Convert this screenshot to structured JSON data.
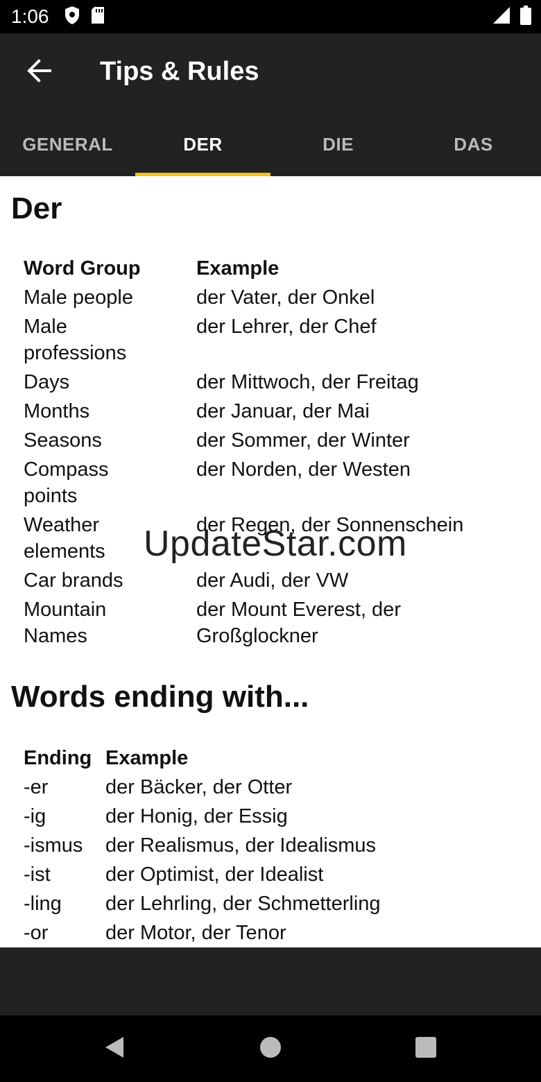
{
  "status": {
    "time": "1:06"
  },
  "app_bar": {
    "title": "Tips & Rules"
  },
  "tabs": [
    {
      "label": "GENERAL"
    },
    {
      "label": "DER"
    },
    {
      "label": "DIE"
    },
    {
      "label": "DAS"
    }
  ],
  "section1": {
    "title": "Der",
    "header": {
      "group": "Word Group",
      "example": "Example"
    },
    "rows": [
      {
        "group": "Male people",
        "example": "der Vater, der Onkel"
      },
      {
        "group": "Male",
        "group2": "professions",
        "example": "der Lehrer, der Chef"
      },
      {
        "group": "Days",
        "example": "der Mittwoch, der Freitag"
      },
      {
        "group": "Months",
        "example": "der Januar, der Mai"
      },
      {
        "group": "Seasons",
        "example": "der Sommer, der Winter"
      },
      {
        "group": "Compass",
        "group2": "points",
        "example": "der Norden, der Westen"
      },
      {
        "group": "Weather",
        "group2": "elements",
        "example": "der Regen, der Sonnenschein"
      },
      {
        "group": "Car brands",
        "example": "der Audi, der VW"
      },
      {
        "group": "Mountain",
        "group2": "Names",
        "example": "der Mount Everest, der",
        "example2": "Großglockner"
      }
    ]
  },
  "section2": {
    "title": "Words ending with...",
    "header": {
      "ending": "Ending",
      "example": "Example"
    },
    "rows": [
      {
        "ending": "-er",
        "example": "der Bäcker, der Otter"
      },
      {
        "ending": "-ig",
        "example": "der Honig, der Essig"
      },
      {
        "ending": "-ismus",
        "example": "der Realismus, der Idealismus"
      },
      {
        "ending": "-ist",
        "example": "der Optimist, der Idealist"
      },
      {
        "ending": "-ling",
        "example": "der Lehrling, der Schmetterling"
      },
      {
        "ending": "-or",
        "example": "der Motor, der Tenor"
      }
    ]
  },
  "watermark": "UpdateStar.com",
  "colors": {
    "accent": "#f6c21c",
    "appbar": "#222222"
  }
}
